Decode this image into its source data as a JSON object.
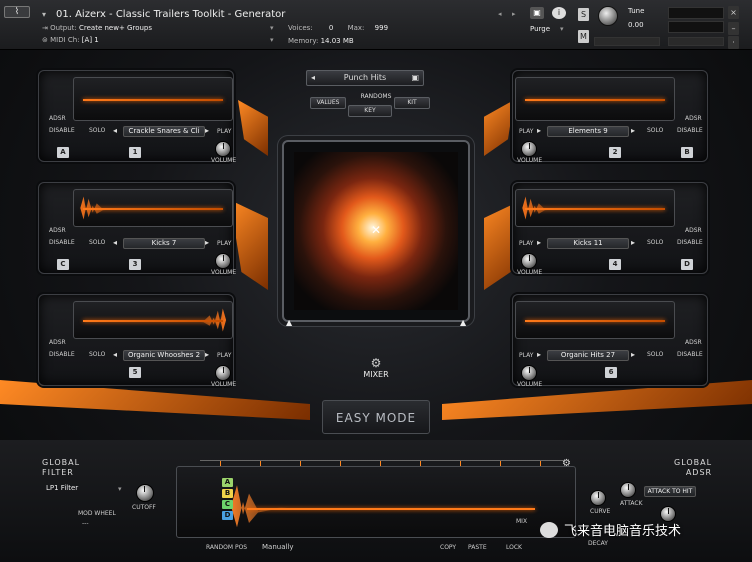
{
  "header": {
    "title": "01. Aizerx - Classic Trailers Toolkit - Generator",
    "output_label": "Output:",
    "output_value": "Create new+ Groups",
    "midi_label": "MIDI Ch:",
    "midi_value": "[A] 1",
    "voices_label": "Voices:",
    "voices_value": "0",
    "max_label": "Max:",
    "max_value": "999",
    "memory_label": "Memory:",
    "memory_value": "14.03 MB",
    "purge_label": "Purge",
    "tune_label": "Tune",
    "tune_value": "0.00",
    "s_label": "S",
    "m_label": "M",
    "info_label": "i",
    "nav_prev": "◂",
    "nav_next": "▸"
  },
  "center": {
    "preset": "Punch Hits",
    "randoms": "RANDOMS",
    "values": "VALUES",
    "kit": "KIT",
    "key": "KEY",
    "mixer": "MIXER",
    "easy_mode": "EASY MODE"
  },
  "slots": [
    {
      "letter": "A",
      "num": "1",
      "name": "Crackle Snares & Cli",
      "side": "left"
    },
    {
      "letter": "B",
      "num": "2",
      "name": "Elements 9",
      "side": "right"
    },
    {
      "letter": "C",
      "num": "3",
      "name": "Kicks 7",
      "side": "left"
    },
    {
      "letter": "D",
      "num": "4",
      "name": "Kicks 11",
      "side": "right"
    },
    {
      "letter": "",
      "num": "5",
      "name": "Organic Whooshes 2",
      "side": "left"
    },
    {
      "letter": "",
      "num": "6",
      "name": "Organic Hits 27",
      "side": "right"
    }
  ],
  "slot_labels": {
    "adsr": "ADSR",
    "disable": "DISABLE",
    "solo": "SOLO",
    "play": "PLAY",
    "volume": "VOLUME"
  },
  "bottom": {
    "global_filter": "GLOBAL\nFILTER",
    "filter_type": "LP1 Filter",
    "cutoff": "CUTOFF",
    "mod_wheel": "MOD WHEEL",
    "mod_value": "---",
    "global_adsr": "GLOBAL\nADSR",
    "attack_to_hit": "ATTACK TO HIT",
    "attack": "ATTACK",
    "curve": "CURVE",
    "decay": "DECAY",
    "random_pos": "RANDOM POS",
    "manually": "Manually",
    "copy": "COPY",
    "paste": "PASTE",
    "lock": "LOCK",
    "mix": "MIX",
    "abcd": [
      "A",
      "B",
      "C",
      "D"
    ]
  },
  "watermark": "飞来音电脑音乐技术",
  "colors": {
    "accent": "#ff7a1a",
    "a": "#9bd36b",
    "b": "#f0d34a",
    "c": "#6bd36b",
    "d": "#4aa0e0"
  }
}
